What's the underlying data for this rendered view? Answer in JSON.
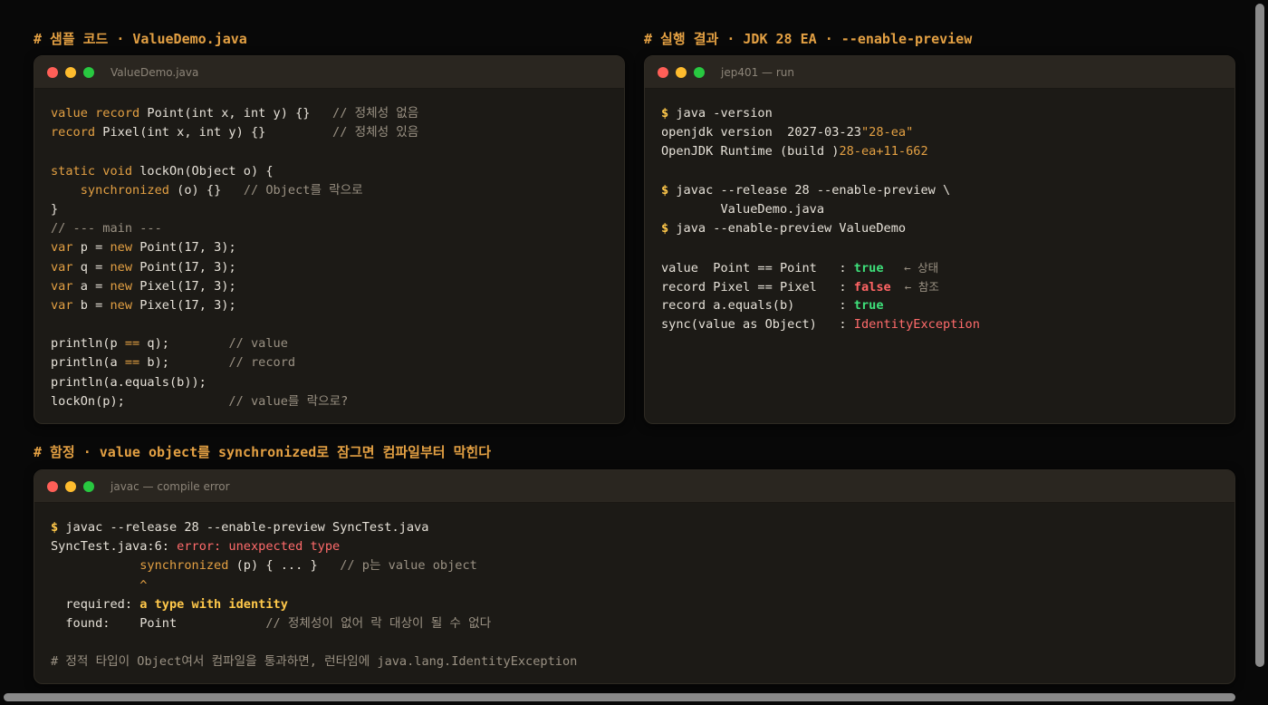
{
  "sections": {
    "sample": "# 샘플 코드 · ValueDemo.java",
    "result": "# 실행 결과 · JDK 28 EA · --enable-preview",
    "pitfall": "# 함정 · value object를 synchronized로 잠그면 컴파일부터 막힌다"
  },
  "windows": {
    "code": {
      "title": "ValueDemo.java",
      "lines": [
        {
          "a": "value record",
          "b": " Point(int x, int y) {}   ",
          "c": "// 정체성 없음"
        },
        {
          "a": "record",
          "b": " Pixel(int x, int y) {}         ",
          "c": "// 정체성 있음"
        },
        {
          "b": ""
        },
        {
          "a": "static void",
          "b": " lockOn(Object o) {"
        },
        {
          "i": "    ",
          "a": "synchronized",
          "b": " (o) {}   ",
          "c": "// Object를 락으로"
        },
        {
          "b": "}"
        },
        {
          "c": "// --- main ---"
        },
        {
          "a": "var",
          "b": " p = ",
          "d": "new",
          "e": " Point(17, 3);"
        },
        {
          "a": "var",
          "b": " q = ",
          "d": "new",
          "e": " Point(17, 3);"
        },
        {
          "a": "var",
          "b": " a = ",
          "d": "new",
          "e": " Pixel(17, 3);"
        },
        {
          "a": "var",
          "b": " b = ",
          "d": "new",
          "e": " Pixel(17, 3);"
        },
        {
          "b": ""
        },
        {
          "b": "println(p ",
          "d": "==",
          "e": " q);        ",
          "c": "// value"
        },
        {
          "b": "println(a ",
          "d": "==",
          "e": " b);        ",
          "c": "// record"
        },
        {
          "b": "println(a.equals(b));"
        },
        {
          "b": "lockOn(p);              ",
          "c": "// value를 락으로?"
        }
      ]
    },
    "run": {
      "title": "jep401 — run",
      "lines": [
        {
          "p": "$ ",
          "b": "java -version"
        },
        {
          "b": "openjdk version ",
          "s": "\"28-ea\"",
          "e": " 2027-03-23"
        },
        {
          "b": "OpenJDK Runtime (build ",
          "s": "28-ea+11-662",
          "e": ")"
        },
        {
          "b": ""
        },
        {
          "p": "$ ",
          "b": "javac --release 28 --enable-preview \\"
        },
        {
          "b": "        ValueDemo.java"
        },
        {
          "p": "$ ",
          "b": "java --enable-preview ValueDemo"
        },
        {
          "b": ""
        },
        {
          "b": "value  Point == Point   : ",
          "ok": "true",
          "ar": "   ← 상태"
        },
        {
          "b": "record Pixel == Pixel   : ",
          "bad": "false",
          "ar": "  ← 참조"
        },
        {
          "b": "record a.equals(b)      : ",
          "ok": "true"
        },
        {
          "b": "sync(value as Object)   : ",
          "err": "IdentityException"
        }
      ]
    },
    "compile": {
      "title": "javac — compile error",
      "lines": [
        {
          "p": "$ ",
          "b": "javac --release 28 --enable-preview SyncTest.java"
        },
        {
          "b": "SyncTest.java:6: ",
          "err": "error: unexpected type"
        },
        {
          "i": "            ",
          "a": "synchronized",
          "b": " (p) { ... }   ",
          "c": "// p는 value object"
        },
        {
          "b": "            ",
          "s": "^"
        },
        {
          "b": "  required: ",
          "hl": "a type with identity"
        },
        {
          "b": "  found:    Point            ",
          "c": "// 정체성이 없어 락 대상이 될 수 없다"
        },
        {
          "b": ""
        },
        {
          "c": "# 정적 타입이 Object여서 컴파일을 통과하면, 런타임에 java.lang.IdentityException"
        }
      ]
    }
  }
}
